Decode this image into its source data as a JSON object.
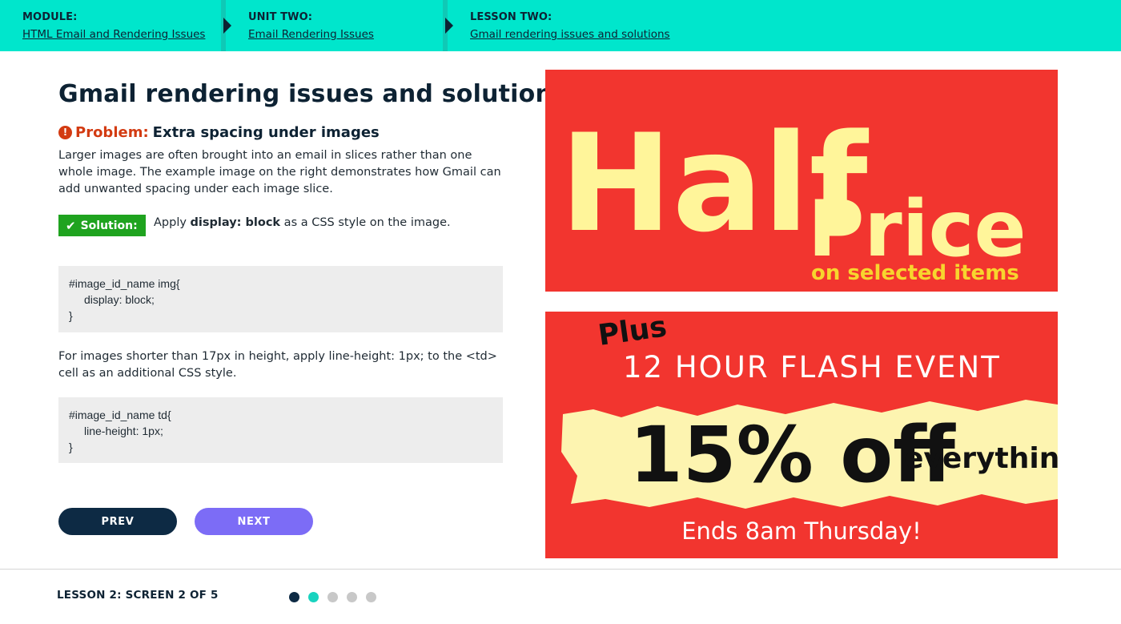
{
  "breadcrumb": {
    "module": {
      "key": "MODULE:",
      "value": "HTML Email and Rendering Issues"
    },
    "unit": {
      "key": "UNIT TWO:",
      "value": "Email Rendering Issues"
    },
    "lesson": {
      "key": "LESSON TWO:",
      "value": "Gmail rendering issues and solutions"
    }
  },
  "main": {
    "title": "Gmail rendering issues and solutions",
    "problem_label": "Problem:",
    "problem_text": "Extra spacing under images",
    "problem_body": "Larger images are often brought into an email in slices rather than one whole image. The example image on the right demonstrates how Gmail can add unwanted spacing under each image slice.",
    "solution_badge": "Solution:",
    "solution_pre": "Apply ",
    "solution_bold": "display: block",
    "solution_post": " as a CSS style on the image.",
    "code1": [
      "#image_id_name img{",
      "display: block;",
      "}"
    ],
    "para2": "For images shorter than 17px in height, apply line-height: 1px; to the <td> cell as an additional CSS style.",
    "code2": [
      "#image_id_name td{",
      "line-height: 1px;",
      "}"
    ]
  },
  "nav": {
    "prev": "PREV",
    "next": "NEXT"
  },
  "banner1": {
    "line1": "Half",
    "line2": "Price",
    "line3": "on selected items"
  },
  "banner2": {
    "plus": "Plus",
    "event": "12 HOUR FLASH EVENT",
    "offer": "15% off",
    "everything": "everything",
    "ends": "Ends 8am Thursday!"
  },
  "footer": {
    "label": "LESSON 2: SCREEN 2 OF 5",
    "progress": {
      "current": 2,
      "total": 5
    }
  },
  "colors": {
    "header": "#00e6cc",
    "problem": "#d33b12",
    "solution": "#1fa31f",
    "prev": "#0d2a44",
    "next": "#7c6cf6",
    "banner": "#f2352f",
    "banner_text": "#fff59a"
  }
}
